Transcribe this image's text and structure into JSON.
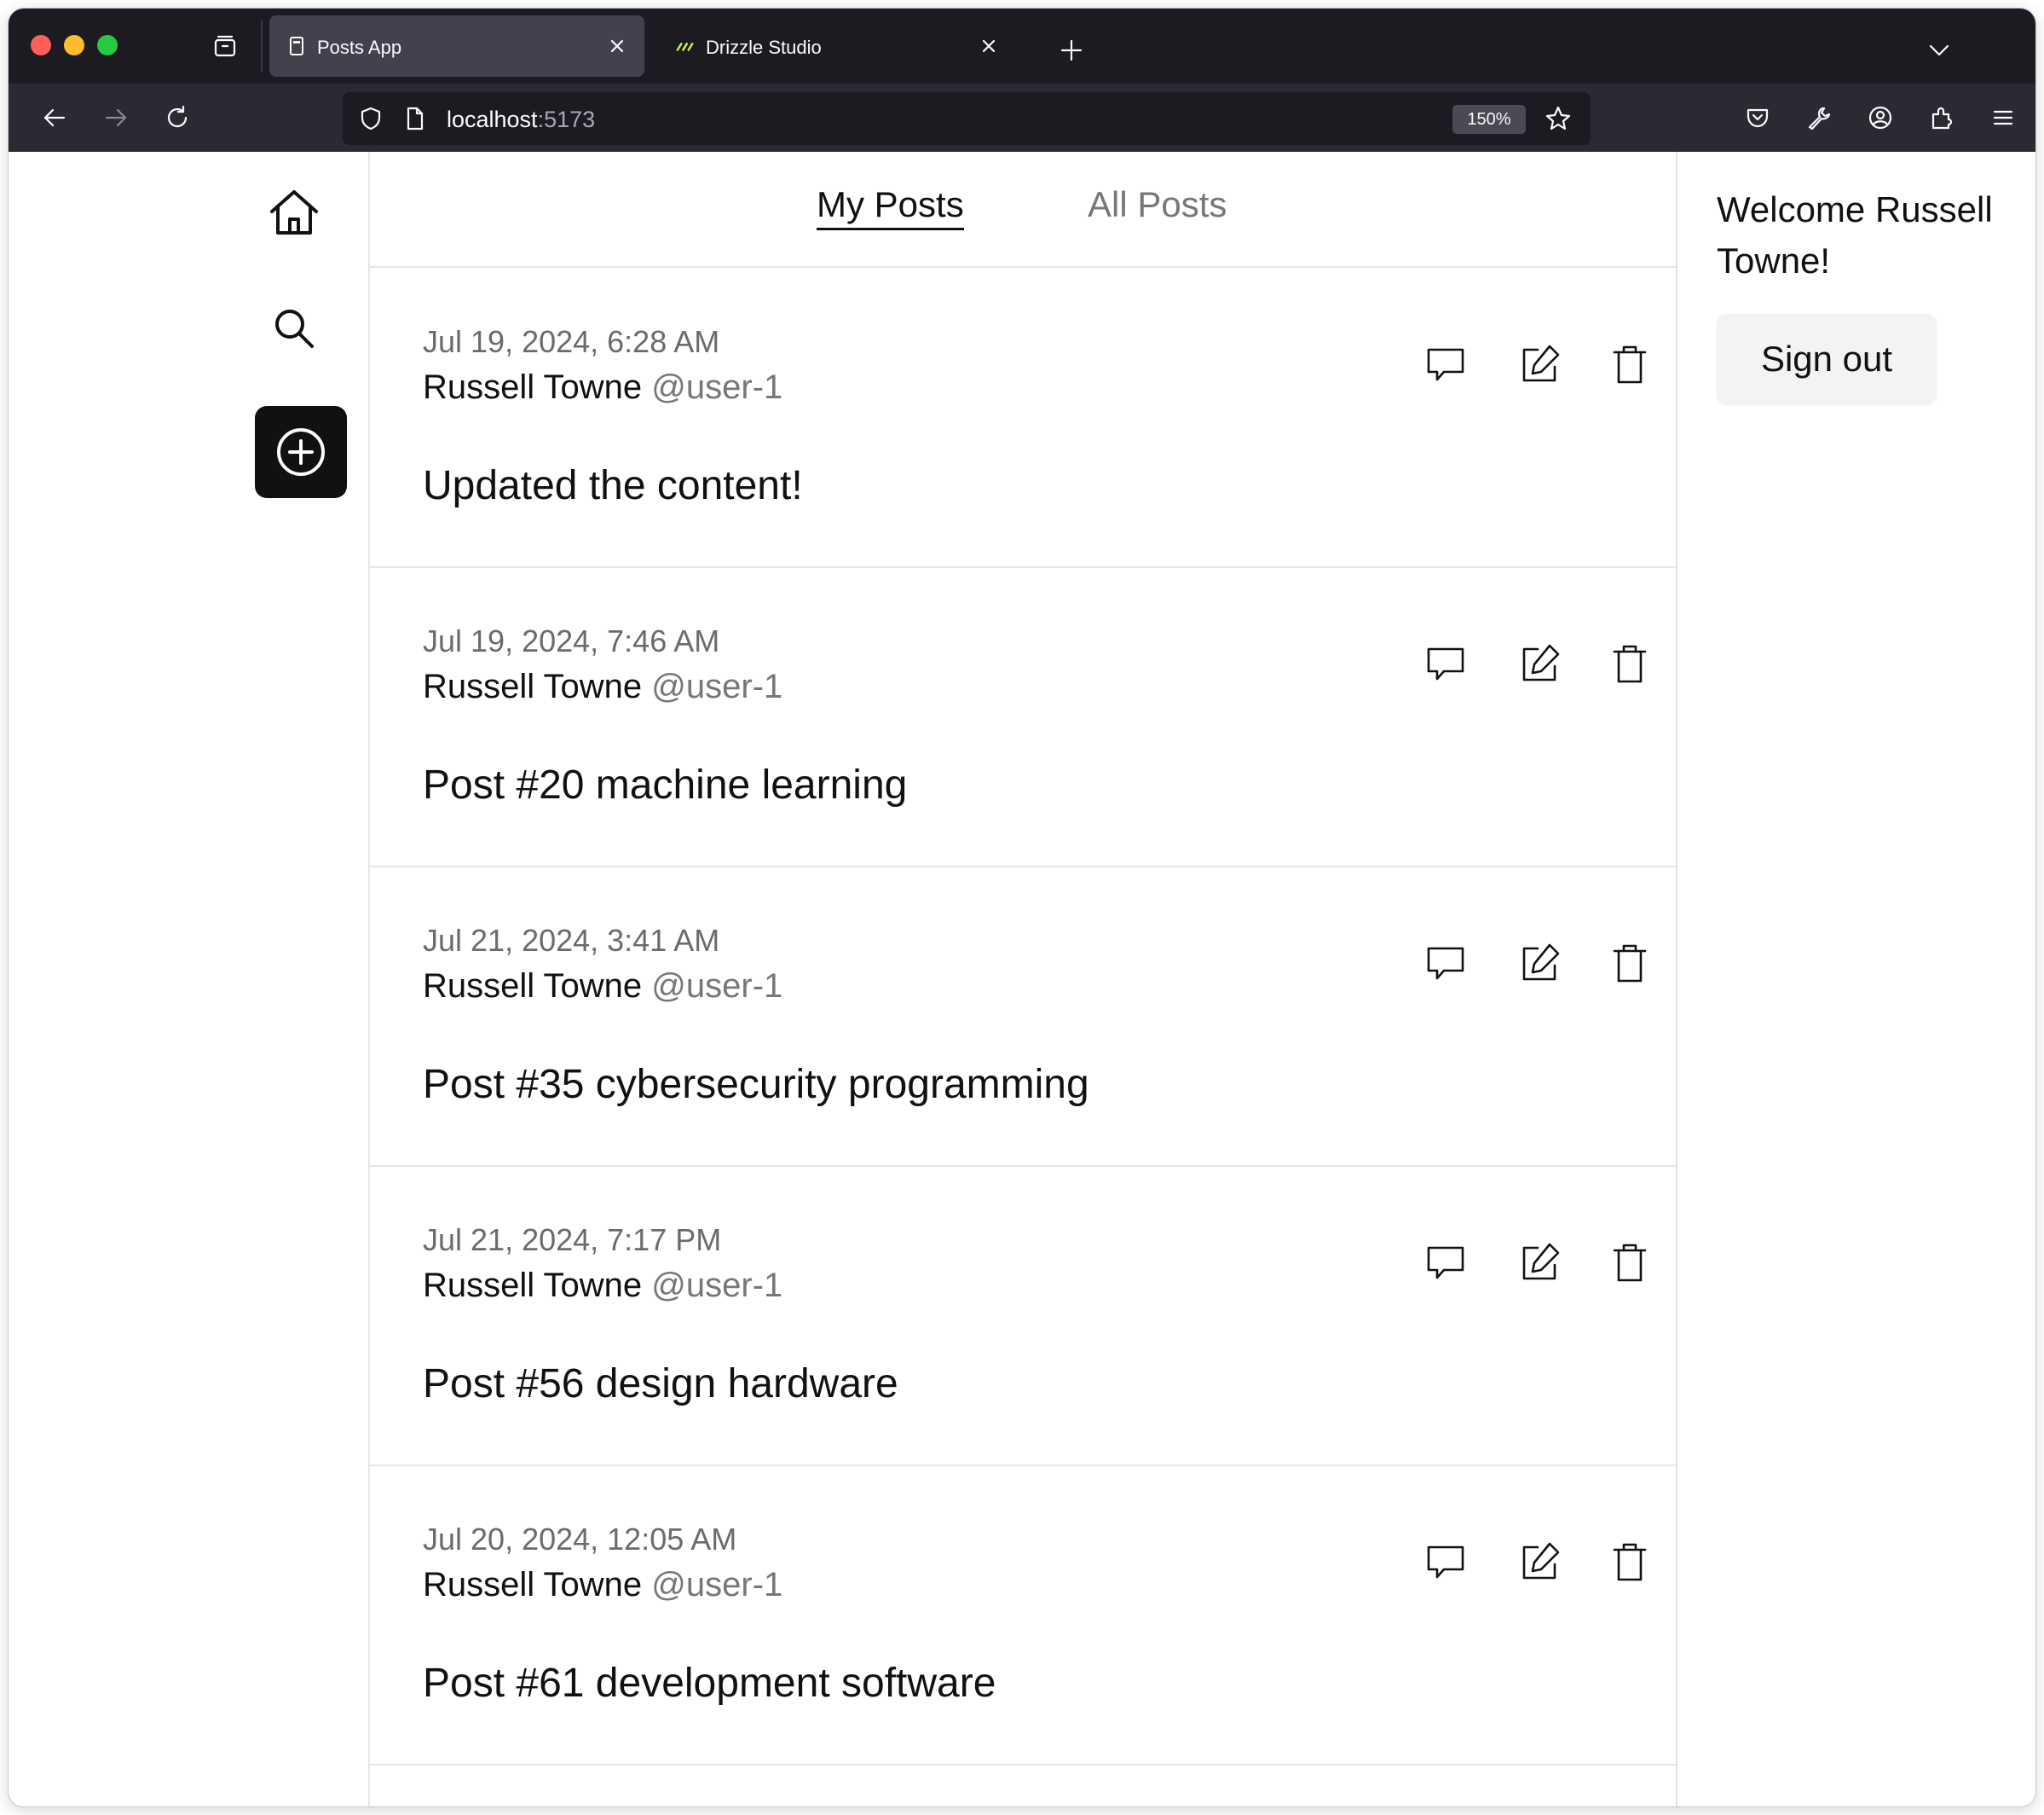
{
  "browser": {
    "tabs": [
      {
        "title": "Posts App",
        "active": true,
        "favicon": "document-icon"
      },
      {
        "title": "Drizzle Studio",
        "active": false,
        "favicon": "drizzle-icon"
      }
    ],
    "url": {
      "host": "localhost",
      "port": ":5173"
    },
    "zoom": "150%"
  },
  "nav": {
    "items": [
      "home-icon",
      "search-icon",
      "create-post-icon"
    ]
  },
  "feed": {
    "tabs": [
      {
        "label": "My Posts",
        "active": true
      },
      {
        "label": "All Posts",
        "active": false
      }
    ],
    "posts": [
      {
        "date": "Jul 19, 2024, 6:28 AM",
        "author": "Russell Towne",
        "handle": "@user-1",
        "content": "Updated the content!"
      },
      {
        "date": "Jul 19, 2024, 7:46 AM",
        "author": "Russell Towne",
        "handle": "@user-1",
        "content": "Post #20 machine learning"
      },
      {
        "date": "Jul 21, 2024, 3:41 AM",
        "author": "Russell Towne",
        "handle": "@user-1",
        "content": "Post #35 cybersecurity programming"
      },
      {
        "date": "Jul 21, 2024, 7:17 PM",
        "author": "Russell Towne",
        "handle": "@user-1",
        "content": "Post #56 design hardware"
      },
      {
        "date": "Jul 20, 2024, 12:05 AM",
        "author": "Russell Towne",
        "handle": "@user-1",
        "content": "Post #61 development software"
      }
    ]
  },
  "sidebar": {
    "welcome": "Welcome Russell Towne!",
    "signout_label": "Sign out"
  },
  "colors": {
    "chrome_dark": "#1c1b22",
    "chrome_nav": "#2b2a33",
    "accent_button": "#111111",
    "muted_text": "#777777"
  }
}
